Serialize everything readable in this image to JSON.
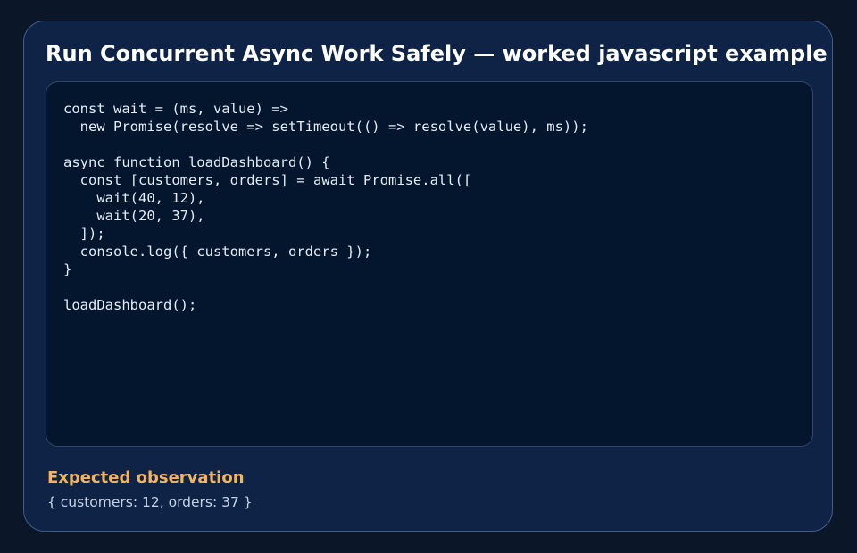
{
  "title": "Run Concurrent Async Work Safely — worked javascript example",
  "code": "const wait = (ms, value) =>\n  new Promise(resolve => setTimeout(() => resolve(value), ms));\n\nasync function loadDashboard() {\n  const [customers, orders] = await Promise.all([\n    wait(40, 12),\n    wait(20, 37),\n  ]);\n  console.log({ customers, orders });\n}\n\nloadDashboard();",
  "observation": {
    "label": "Expected observation",
    "value": "{ customers: 12, orders: 37 }"
  },
  "colors": {
    "background": "#0b1628",
    "card": "#0e2345",
    "code_panel": "#03162d",
    "accent": "#f4b35e"
  }
}
